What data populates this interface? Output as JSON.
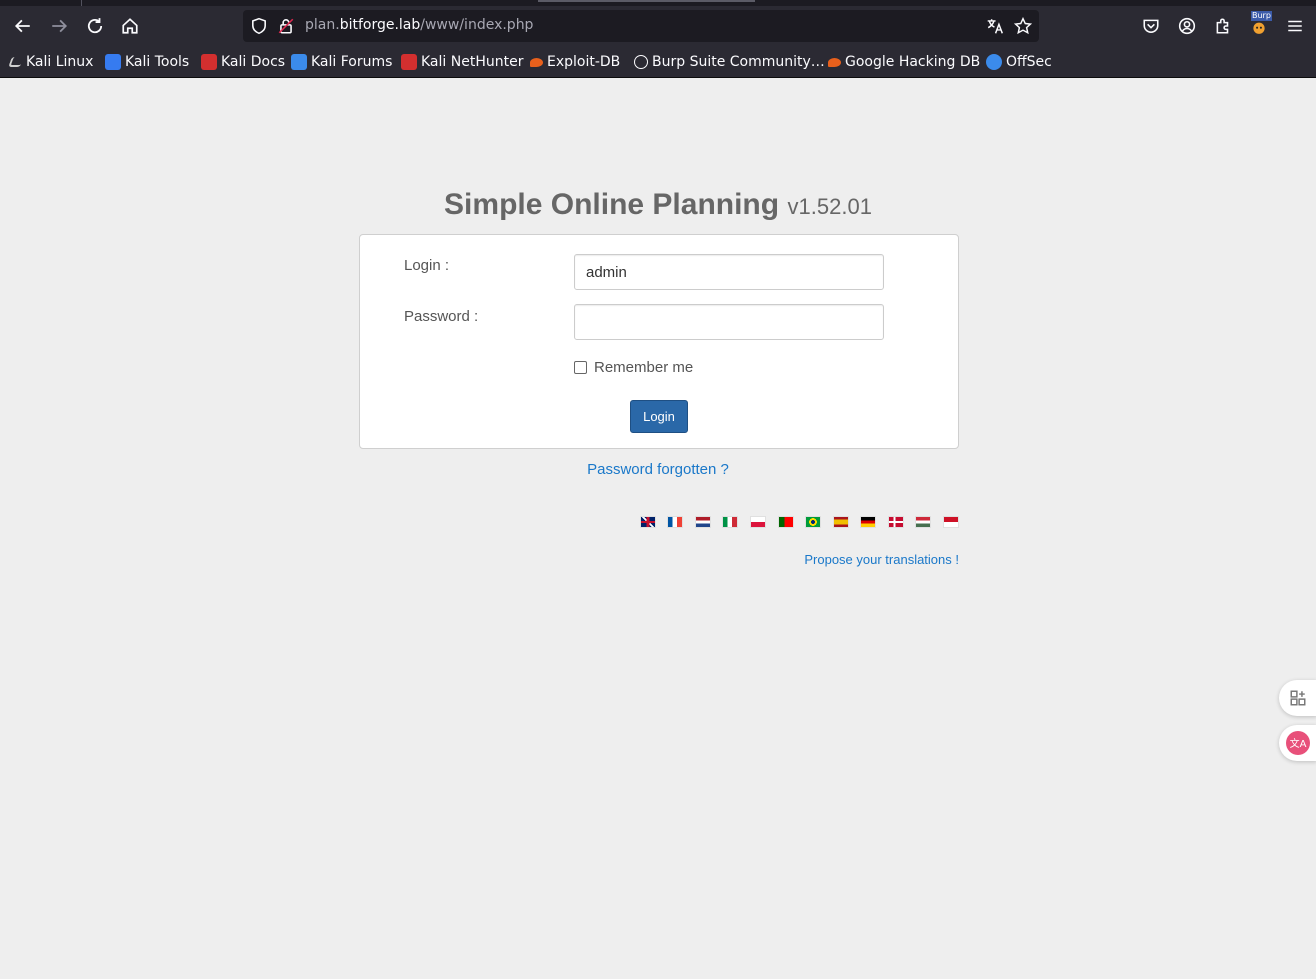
{
  "browser": {
    "url_prefix": "plan.",
    "url_host": "bitforge.lab",
    "url_path": "/www/index.php",
    "burp_badge": "Burp"
  },
  "bookmarks": [
    {
      "label": "Kali Linux",
      "icon": "kali-dragon-icon",
      "color": "#1f1f1f"
    },
    {
      "label": "Kali Tools",
      "icon": "kali-tools-icon",
      "color": "#367bf0"
    },
    {
      "label": "Kali Docs",
      "icon": "kali-docs-icon",
      "color": "#d32f2f"
    },
    {
      "label": "Kali Forums",
      "icon": "kali-forums-icon",
      "color": "#3b8beb"
    },
    {
      "label": "Kali NetHunter",
      "icon": "nethunter-icon",
      "color": "#d32f2f"
    },
    {
      "label": "Exploit-DB",
      "icon": "exploit-db-icon",
      "color": "#e8601c"
    },
    {
      "label": "Burp Suite Community…",
      "icon": "globe-icon",
      "color": "#fbfbfe"
    },
    {
      "label": "Google Hacking DB",
      "icon": "ghdb-icon",
      "color": "#e8601c"
    },
    {
      "label": "OffSec",
      "icon": "offsec-icon",
      "color": "#3b8beb"
    }
  ],
  "page": {
    "app_name": "Simple Online Planning",
    "version": "v1.52.01",
    "login_label": "Login :",
    "login_value": "admin",
    "password_label": "Password :",
    "password_value": "",
    "remember_label": "Remember me",
    "login_button": "Login",
    "forgot_link": "Password forgotten ?",
    "propose_link": "Propose your translations !",
    "flags": [
      "en",
      "fr",
      "nl",
      "it",
      "pl",
      "pt",
      "br",
      "es",
      "de",
      "da",
      "hu",
      "id"
    ]
  },
  "colors": {
    "link": "#1a78c9",
    "button": "#2a68a8",
    "page_bg": "#eeeeee"
  }
}
